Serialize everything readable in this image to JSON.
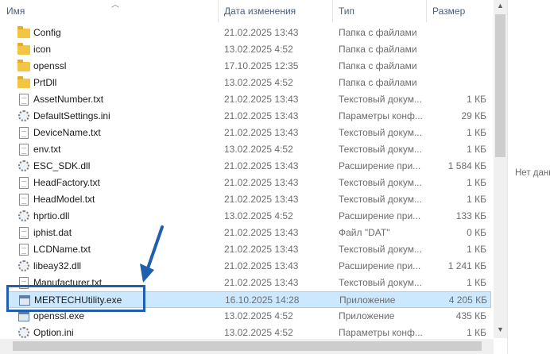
{
  "columns": {
    "name": "Имя",
    "date": "Дата изменения",
    "type": "Тип",
    "size": "Размер"
  },
  "files": [
    {
      "name": "Config",
      "date": "21.02.2025 13:43",
      "type": "Папка с файлами",
      "size": "",
      "icon": "folder-icon"
    },
    {
      "name": "icon",
      "date": "13.02.2025 4:52",
      "type": "Папка с файлами",
      "size": "",
      "icon": "folder-icon"
    },
    {
      "name": "openssl",
      "date": "17.10.2025 12:35",
      "type": "Папка с файлами",
      "size": "",
      "icon": "folder-icon"
    },
    {
      "name": "PrtDll",
      "date": "13.02.2025 4:52",
      "type": "Папка с файлами",
      "size": "",
      "icon": "folder-icon"
    },
    {
      "name": "AssetNumber.txt",
      "date": "21.02.2025 13:43",
      "type": "Текстовый докум...",
      "size": "1 КБ",
      "icon": "text-file-icon"
    },
    {
      "name": "DefaultSettings.ini",
      "date": "21.02.2025 13:43",
      "type": "Параметры конф...",
      "size": "29 КБ",
      "icon": "settings-file-icon"
    },
    {
      "name": "DeviceName.txt",
      "date": "21.02.2025 13:43",
      "type": "Текстовый докум...",
      "size": "1 КБ",
      "icon": "text-file-icon"
    },
    {
      "name": "env.txt",
      "date": "13.02.2025 4:52",
      "type": "Текстовый докум...",
      "size": "1 КБ",
      "icon": "text-file-icon"
    },
    {
      "name": "ESC_SDK.dll",
      "date": "21.02.2025 13:43",
      "type": "Расширение при...",
      "size": "1 584 КБ",
      "icon": "dll-file-icon"
    },
    {
      "name": "HeadFactory.txt",
      "date": "21.02.2025 13:43",
      "type": "Текстовый докум...",
      "size": "1 КБ",
      "icon": "text-file-icon"
    },
    {
      "name": "HeadModel.txt",
      "date": "21.02.2025 13:43",
      "type": "Текстовый докум...",
      "size": "1 КБ",
      "icon": "text-file-icon"
    },
    {
      "name": "hprtio.dll",
      "date": "13.02.2025 4:52",
      "type": "Расширение при...",
      "size": "133 КБ",
      "icon": "dll-file-icon"
    },
    {
      "name": "iphist.dat",
      "date": "21.02.2025 13:43",
      "type": "Файл \"DAT\"",
      "size": "0 КБ",
      "icon": "file-icon"
    },
    {
      "name": "LCDName.txt",
      "date": "21.02.2025 13:43",
      "type": "Текстовый докум...",
      "size": "1 КБ",
      "icon": "text-file-icon"
    },
    {
      "name": "libeay32.dll",
      "date": "21.02.2025 13:43",
      "type": "Расширение при...",
      "size": "1 241 КБ",
      "icon": "dll-file-icon"
    },
    {
      "name": "Manufacturer.txt",
      "date": "21.02.2025 13:43",
      "type": "Текстовый докум...",
      "size": "1 КБ",
      "icon": "text-file-icon"
    },
    {
      "name": "MERTECHUtility.exe",
      "date": "16.10.2025 14:28",
      "type": "Приложение",
      "size": "4 205 КБ",
      "icon": "exe-file-icon",
      "selected": true
    },
    {
      "name": "openssl.exe",
      "date": "13.02.2025 4:52",
      "type": "Приложение",
      "size": "435 КБ",
      "icon": "exe-file-icon"
    },
    {
      "name": "Option.ini",
      "date": "13.02.2025 4:52",
      "type": "Параметры конф...",
      "size": "1 КБ",
      "icon": "settings-file-icon"
    }
  ],
  "details_pane": {
    "text": "Нет данн"
  },
  "colors": {
    "selection": "#cce8ff",
    "annotation": "#1f5fae",
    "folder": "#f4c545"
  }
}
